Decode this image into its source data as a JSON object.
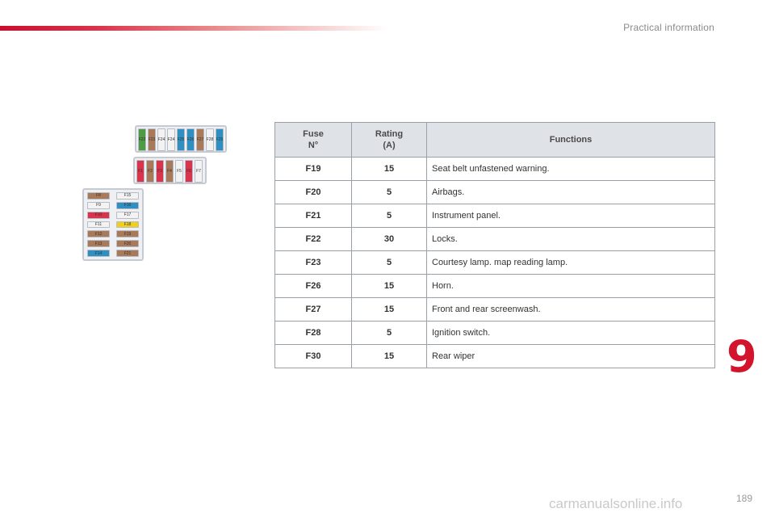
{
  "header": {
    "section_title": "Practical information",
    "brand_color": "#c8102e"
  },
  "chapter": {
    "number": "9",
    "color": "#d2152c"
  },
  "page": {
    "number": "189"
  },
  "watermark": "carmanualsonline.info",
  "table": {
    "headers": {
      "fuse": "Fuse\nN°",
      "rating": "Rating\n(A)",
      "functions": "Functions"
    },
    "rows": [
      {
        "fuse": "F19",
        "rating": "15",
        "function": "Seat belt unfastened warning."
      },
      {
        "fuse": "F20",
        "rating": "5",
        "function": "Airbags."
      },
      {
        "fuse": "F21",
        "rating": "5",
        "function": "Instrument panel."
      },
      {
        "fuse": "F22",
        "rating": "30",
        "function": "Locks."
      },
      {
        "fuse": "F23",
        "rating": "5",
        "function": "Courtesy lamp. map reading lamp."
      },
      {
        "fuse": "F26",
        "rating": "15",
        "function": "Horn."
      },
      {
        "fuse": "F27",
        "rating": "15",
        "function": "Front and rear screenwash."
      },
      {
        "fuse": "F28",
        "rating": "5",
        "function": "Ignition switch."
      },
      {
        "fuse": "F30",
        "rating": "15",
        "function": "Rear wiper"
      }
    ]
  },
  "diagram": {
    "top_row": [
      {
        "label": "F22",
        "color": "#4f9a45"
      },
      {
        "label": "F23",
        "color": "#a87a5a"
      },
      {
        "label": "F24",
        "color": "#f3f3f3"
      },
      {
        "label": "F24",
        "color": "#f3f3f3"
      },
      {
        "label": "F25",
        "color": "#2f8fc0"
      },
      {
        "label": "F26",
        "color": "#2f8fc0"
      },
      {
        "label": "F27",
        "color": "#a87a5a"
      },
      {
        "label": "F28",
        "color": "#f3f3f3"
      },
      {
        "label": "F29",
        "color": "#2f8fc0"
      }
    ],
    "middle_row": [
      {
        "label": "F1",
        "color": "#d9344b"
      },
      {
        "label": "F2",
        "color": "#a87a5a"
      },
      {
        "label": "F3",
        "color": "#d9344b"
      },
      {
        "label": "F4",
        "color": "#a87a5a"
      },
      {
        "label": "F5",
        "color": "#f3f3f3"
      },
      {
        "label": "F6",
        "color": "#d9344b"
      },
      {
        "label": "F7",
        "color": "#f3f3f3"
      }
    ],
    "left_col": [
      {
        "label": "F8",
        "color": "#a87a5a"
      },
      {
        "label": "F9",
        "color": "#f3f3f3"
      },
      {
        "label": "F10",
        "color": "#d9344b"
      },
      {
        "label": "F11",
        "color": "#f3f3f3"
      },
      {
        "label": "F12",
        "color": "#a87a5a"
      },
      {
        "label": "F13",
        "color": "#a87a5a"
      },
      {
        "label": "F14",
        "color": "#2f8fc0"
      }
    ],
    "right_col": [
      {
        "label": "F15",
        "color": "#f3f3f3"
      },
      {
        "label": "F16",
        "color": "#2f8fc0"
      },
      {
        "label": "F17",
        "color": "#f3f3f3"
      },
      {
        "label": "F18",
        "color": "#f2d01a"
      },
      {
        "label": "F19",
        "color": "#a87a5a"
      },
      {
        "label": "F20",
        "color": "#a87a5a"
      },
      {
        "label": "F21",
        "color": "#a87a5a"
      }
    ]
  }
}
